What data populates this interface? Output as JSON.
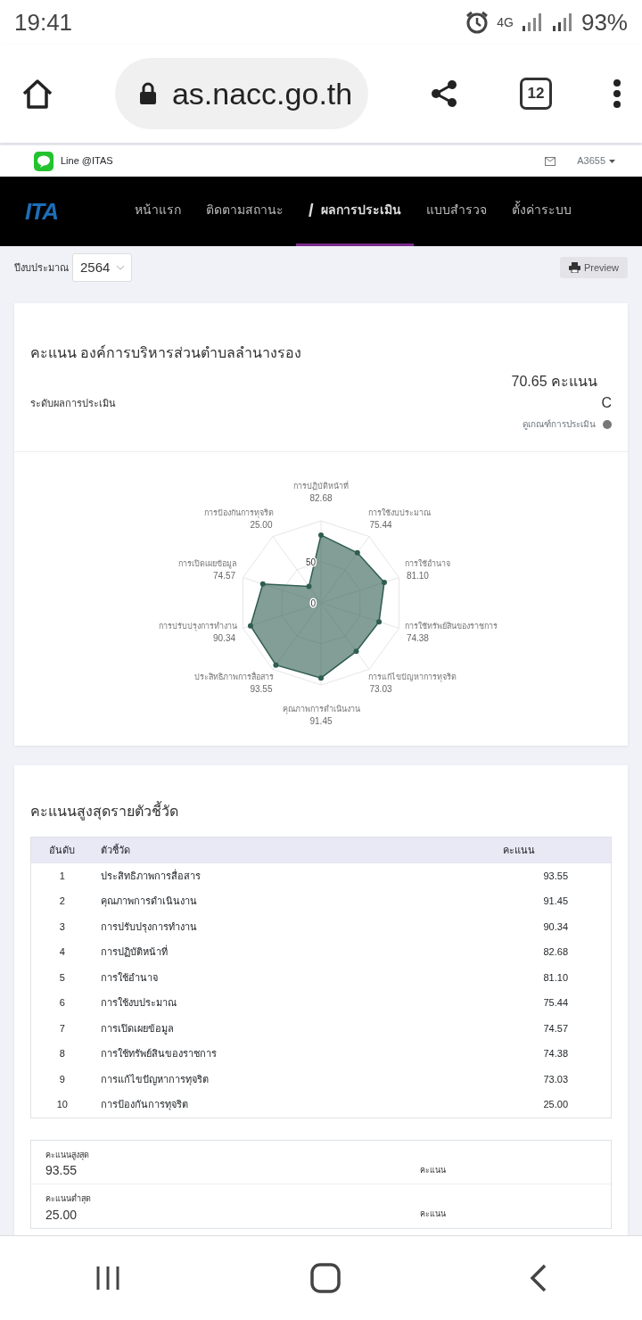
{
  "status_bar": {
    "time": "19:41",
    "network": "4G",
    "battery": "93%"
  },
  "browser": {
    "url": "as.nacc.go.th",
    "tab_count": "12"
  },
  "site_header": {
    "line_label": "Line @ITAS",
    "user": "A3655"
  },
  "nav": {
    "logo": "ITA",
    "marker": "/",
    "items": [
      {
        "label": "หน้าแรก",
        "selected": false
      },
      {
        "label": "ติดตามสถานะ",
        "selected": false
      },
      {
        "label": "ผลการประเมิน",
        "selected": true
      },
      {
        "label": "แบบสำรวจ",
        "selected": false
      },
      {
        "label": "ตั้งค่าระบบ",
        "selected": false
      }
    ]
  },
  "filter": {
    "label": "ปีงบประมาณ",
    "value": "2564"
  },
  "preview_button": "Preview",
  "score_card": {
    "title": "คะแนน องค์การบริหารส่วนตำบลลำนางรอง",
    "score": "70.65 คะแนน",
    "level_label": "ระดับผลการประเมิน",
    "grade": "C",
    "criteria_link": "ดูเกณฑ์การประเมิน"
  },
  "chart": {
    "chart_data": {
      "type": "radar",
      "categories": [
        "การปฏิบัติหน้าที่",
        "การใช้งบประมาณ",
        "การใช้อำนาจ",
        "การใช้ทรัพย์สินของราชการ",
        "การแก้ไขปัญหาการทุจริต",
        "คุณภาพการดำเนินงาน",
        "ประสิทธิภาพการสื่อสาร",
        "การปรับปรุงการทำงาน",
        "การเปิดเผยข้อมูล",
        "การป้องกันการทุจริต"
      ],
      "series": [
        {
          "color": "#2f5d50",
          "values": [
            82.68,
            75.44,
            81.1,
            74.38,
            73.03,
            91.45,
            93.55,
            90.34,
            74.57,
            25.0
          ]
        }
      ],
      "value_labels": [
        "82.68",
        "75.44",
        "81.10",
        "74.38",
        "73.03",
        "91.45",
        "93.55",
        "90.34",
        "74.57",
        "25.00"
      ],
      "ylim": [
        0,
        100
      ],
      "yticks": [
        0,
        50
      ]
    }
  },
  "ranking": {
    "title": "คะแนนสูงสุดรายตัวชี้วัด",
    "columns": [
      "อันดับ",
      "ตัวชี้วัด",
      "คะแนน"
    ],
    "rows": [
      [
        "1",
        "ประสิทธิภาพการสื่อสาร",
        "93.55"
      ],
      [
        "2",
        "คุณภาพการดำเนินงาน",
        "91.45"
      ],
      [
        "3",
        "การปรับปรุงการทำงาน",
        "90.34"
      ],
      [
        "4",
        "การปฏิบัติหน้าที่",
        "82.68"
      ],
      [
        "5",
        "การใช้อำนาจ",
        "81.10"
      ],
      [
        "6",
        "การใช้งบประมาณ",
        "75.44"
      ],
      [
        "7",
        "การเปิดเผยข้อมูล",
        "74.57"
      ],
      [
        "8",
        "การใช้ทรัพย์สินของราชการ",
        "74.38"
      ],
      [
        "9",
        "การแก้ไขปัญหาการทุจริต",
        "73.03"
      ],
      [
        "10",
        "การป้องกันการทุจริต",
        "25.00"
      ]
    ]
  },
  "summary": [
    {
      "label": "คะแนนสูงสุด",
      "value": "93.55",
      "unit": "คะแนน"
    },
    {
      "label": "คะแนนต่ำสุด",
      "value": "25.00",
      "unit": "คะแนน"
    }
  ]
}
